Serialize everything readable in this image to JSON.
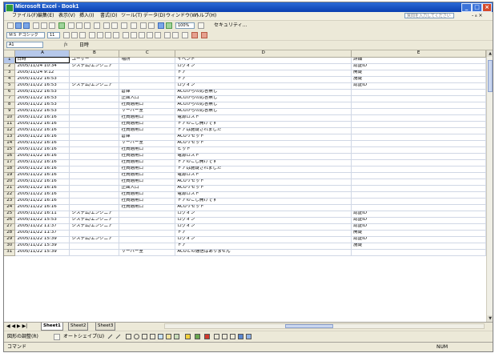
{
  "window": {
    "title": "Microsoft Excel - Book1",
    "minimize": "_",
    "maximize": "□",
    "close": "×"
  },
  "menu": {
    "items": [
      "ファイル(F)",
      "編集(E)",
      "表示(V)",
      "挿入(I)",
      "書式(O)",
      "ツール(T)",
      "データ(D)",
      "ウィンドウ(W)",
      "ヘルプ(H)"
    ],
    "help_placeholder": "質問を入力してください",
    "window_controls": "- ₈ ×"
  },
  "toolbar": {
    "zoom": "100%",
    "font_name": "ＭＳ Ｐゴシック",
    "font_size": "11",
    "extra_label": "セキュリティ..."
  },
  "formula_bar": {
    "name_box": "A1",
    "fx": "fx",
    "value": "日時"
  },
  "columns": [
    "A",
    "B",
    "C",
    "D",
    "E"
  ],
  "rows": [
    {
      "n": "1",
      "a": "日時",
      "b": "ユーザー",
      "c": "場所",
      "d": "イベント",
      "e": "詳細"
    },
    {
      "n": "2",
      "a": "2005/11/24 10:34",
      "b": "システム/エンジニア",
      "c": "",
      "d": "ログオン",
      "e": "認証ID"
    },
    {
      "n": "3",
      "a": "2005/11/24 9:12",
      "b": "",
      "c": "",
      "d": "ドア",
      "e": "開錠"
    },
    {
      "n": "4",
      "a": "2005/11/22 16:53",
      "b": "",
      "c": "",
      "d": "ドア",
      "e": "施錠"
    },
    {
      "n": "5",
      "a": "2005/11/22 16:53",
      "b": "システム/エンジニア",
      "c": "",
      "d": "ログオン",
      "e": "認証ID"
    },
    {
      "n": "6",
      "a": "2005/11/22 16:53",
      "b": "",
      "c": "倉庫",
      "d": "ACUからの応答無し",
      "e": ""
    },
    {
      "n": "7",
      "a": "2005/11/22 16:53",
      "b": "",
      "c": "正面入口",
      "d": "ACUからの応答無し",
      "e": ""
    },
    {
      "n": "8",
      "a": "2005/11/22 16:53",
      "b": "",
      "c": "社員通用口",
      "d": "ACUからの応答無し",
      "e": ""
    },
    {
      "n": "9",
      "a": "2005/11/22 16:53",
      "b": "",
      "c": "サーバー室",
      "d": "ACUからの応答無し",
      "e": ""
    },
    {
      "n": "10",
      "a": "2005/11/22 16:16",
      "b": "",
      "c": "社員通用口",
      "d": "電源ロスト",
      "e": ""
    },
    {
      "n": "11",
      "a": "2005/11/22 16:16",
      "b": "",
      "c": "社員通用口",
      "d": "ドアのこじ開けです",
      "e": ""
    },
    {
      "n": "12",
      "a": "2005/11/22 16:16",
      "b": "",
      "c": "社員通用口",
      "d": "ドアは施錠されました",
      "e": ""
    },
    {
      "n": "13",
      "a": "2005/11/22 16:16",
      "b": "",
      "c": "倉庫",
      "d": "ACUリセット",
      "e": ""
    },
    {
      "n": "14",
      "a": "2005/11/22 16:16",
      "b": "",
      "c": "サーバー室",
      "d": "ACUリセット",
      "e": ""
    },
    {
      "n": "15",
      "a": "2005/11/22 16:16",
      "b": "",
      "c": "社員通用口",
      "d": "ヒット",
      "e": ""
    },
    {
      "n": "16",
      "a": "2005/11/22 16:16",
      "b": "",
      "c": "社員通用口",
      "d": "電源ロスト",
      "e": ""
    },
    {
      "n": "17",
      "a": "2005/11/22 16:16",
      "b": "",
      "c": "社員通用口",
      "d": "ドアのこじ開けです",
      "e": ""
    },
    {
      "n": "18",
      "a": "2005/11/22 16:16",
      "b": "",
      "c": "社員通用口",
      "d": "ドアは施錠されました",
      "e": ""
    },
    {
      "n": "19",
      "a": "2005/11/22 16:16",
      "b": "",
      "c": "社員通用口",
      "d": "電源ロスト",
      "e": ""
    },
    {
      "n": "20",
      "a": "2005/11/22 16:16",
      "b": "",
      "c": "社員通用口",
      "d": "ACUリセット",
      "e": ""
    },
    {
      "n": "21",
      "a": "2005/11/22 16:16",
      "b": "",
      "c": "正面入口",
      "d": "ACUリセット",
      "e": ""
    },
    {
      "n": "22",
      "a": "2005/11/22 16:16",
      "b": "",
      "c": "社員通用口",
      "d": "電源ロスト",
      "e": ""
    },
    {
      "n": "23",
      "a": "2005/11/22 16:16",
      "b": "",
      "c": "社員通用口",
      "d": "ドアのこじ開けです",
      "e": ""
    },
    {
      "n": "24",
      "a": "2005/11/22 16:16",
      "b": "",
      "c": "社員通用口",
      "d": "ACUリセット",
      "e": ""
    },
    {
      "n": "25",
      "a": "2005/11/22 16:11",
      "b": "システム/エンジニア",
      "c": "",
      "d": "ログオン",
      "e": "認証ID"
    },
    {
      "n": "26",
      "a": "2005/11/22 15:53",
      "b": "システム/エンジニア",
      "c": "",
      "d": "ログオン",
      "e": "認証ID"
    },
    {
      "n": "27",
      "a": "2005/11/22 11:37",
      "b": "システム/エンジニア",
      "c": "",
      "d": "ログオン",
      "e": "認証ID"
    },
    {
      "n": "28",
      "a": "2005/11/22 11:37",
      "b": "",
      "c": "",
      "d": "ドア",
      "e": "開錠"
    },
    {
      "n": "29",
      "a": "2005/11/22 15:39",
      "b": "システム/エンジニア",
      "c": "",
      "d": "ログオン",
      "e": "認証ID"
    },
    {
      "n": "30",
      "a": "2005/11/22 15:39",
      "b": "",
      "c": "",
      "d": "ドア",
      "e": "施錠"
    },
    {
      "n": "31",
      "a": "2005/11/22 15:39",
      "b": "",
      "c": "サーバー室",
      "d": "ACUとの通信はありません",
      "e": ""
    }
  ],
  "sheet_tabs": {
    "nav": "◀ ◀ ▶ ▶|",
    "tabs": [
      "Sheet1",
      "Sheet2",
      "Sheet3"
    ]
  },
  "drawing_toolbar": {
    "draw_label": "図形の調整(R)",
    "autoshape_label": "オートシェイプ(U)"
  },
  "status": {
    "left": "コマンド",
    "right": "NUM"
  }
}
